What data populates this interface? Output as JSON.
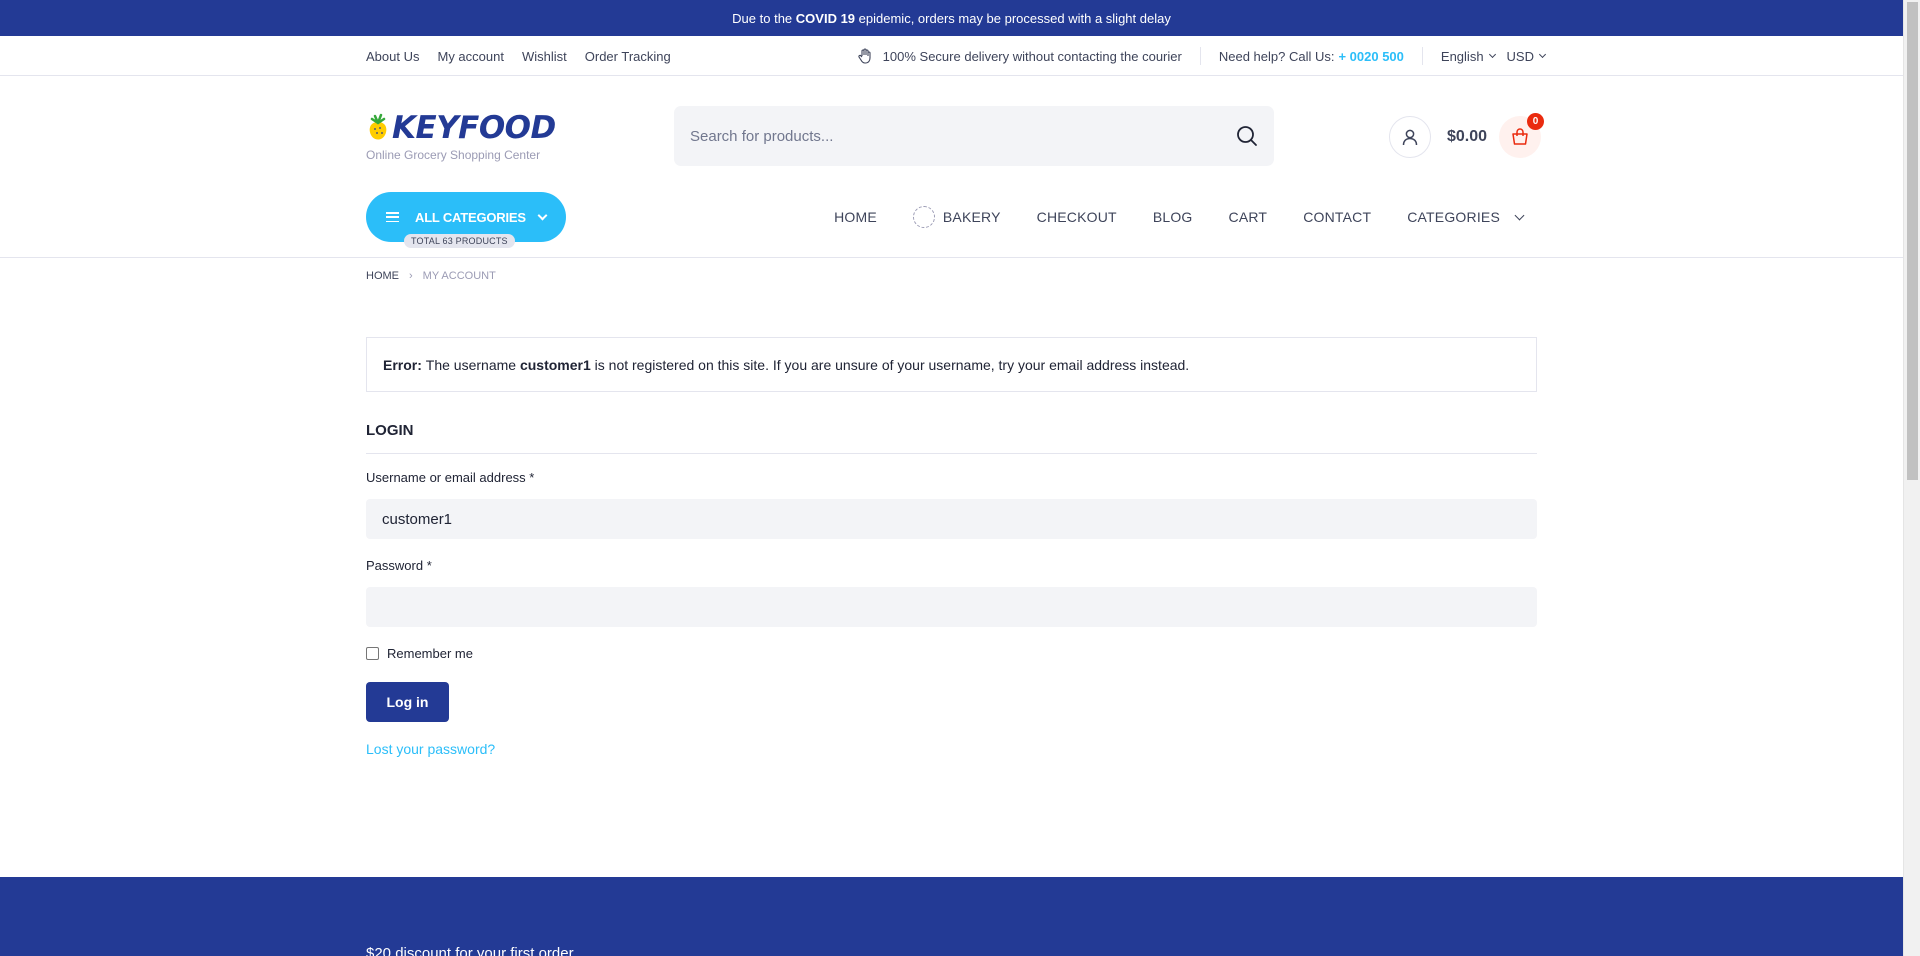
{
  "announcement": {
    "prefix": "Due to the",
    "highlight": "COVID 19",
    "suffix": "epidemic, orders may be processed with a slight delay"
  },
  "topnav": {
    "links": [
      "About Us",
      "My account",
      "Wishlist",
      "Order Tracking"
    ],
    "secure_text": "100% Secure delivery without contacting the courier",
    "help_text": "Need help? Call Us:",
    "phone": "+ 0020 500",
    "language": "English",
    "currency": "USD"
  },
  "header": {
    "logo_text": "KEYFOOD",
    "logo_tagline": "Online Grocery Shopping Center",
    "search_placeholder": "Search for products...",
    "cart_total": "$0.00",
    "cart_count": "0"
  },
  "categories_button": {
    "label": "ALL CATEGORIES",
    "total": "TOTAL 63 PRODUCTS"
  },
  "nav": {
    "home": "HOME",
    "bakery": "BAKERY",
    "checkout": "CHECKOUT",
    "blog": "BLOG",
    "cart": "CART",
    "contact": "CONTACT",
    "categories": "CATEGORIES"
  },
  "breadcrumb": {
    "home": "HOME",
    "current": "MY ACCOUNT"
  },
  "error": {
    "label": "Error:",
    "text_before": "The username",
    "username": "customer1",
    "text_after": "is not registered on this site. If you are unsure of your username, try your email address instead."
  },
  "login": {
    "title": "LOGIN",
    "username_label": "Username or email address *",
    "username_value": "customer1",
    "password_label": "Password *",
    "password_value": "",
    "remember_label": "Remember me",
    "submit_label": "Log in",
    "lost_password": "Lost your password?"
  },
  "footer": {
    "promo": "$20 discount for your first order"
  },
  "colors": {
    "primary": "#233a95",
    "accent": "#2bbef9",
    "badge": "#ea2b0f"
  }
}
